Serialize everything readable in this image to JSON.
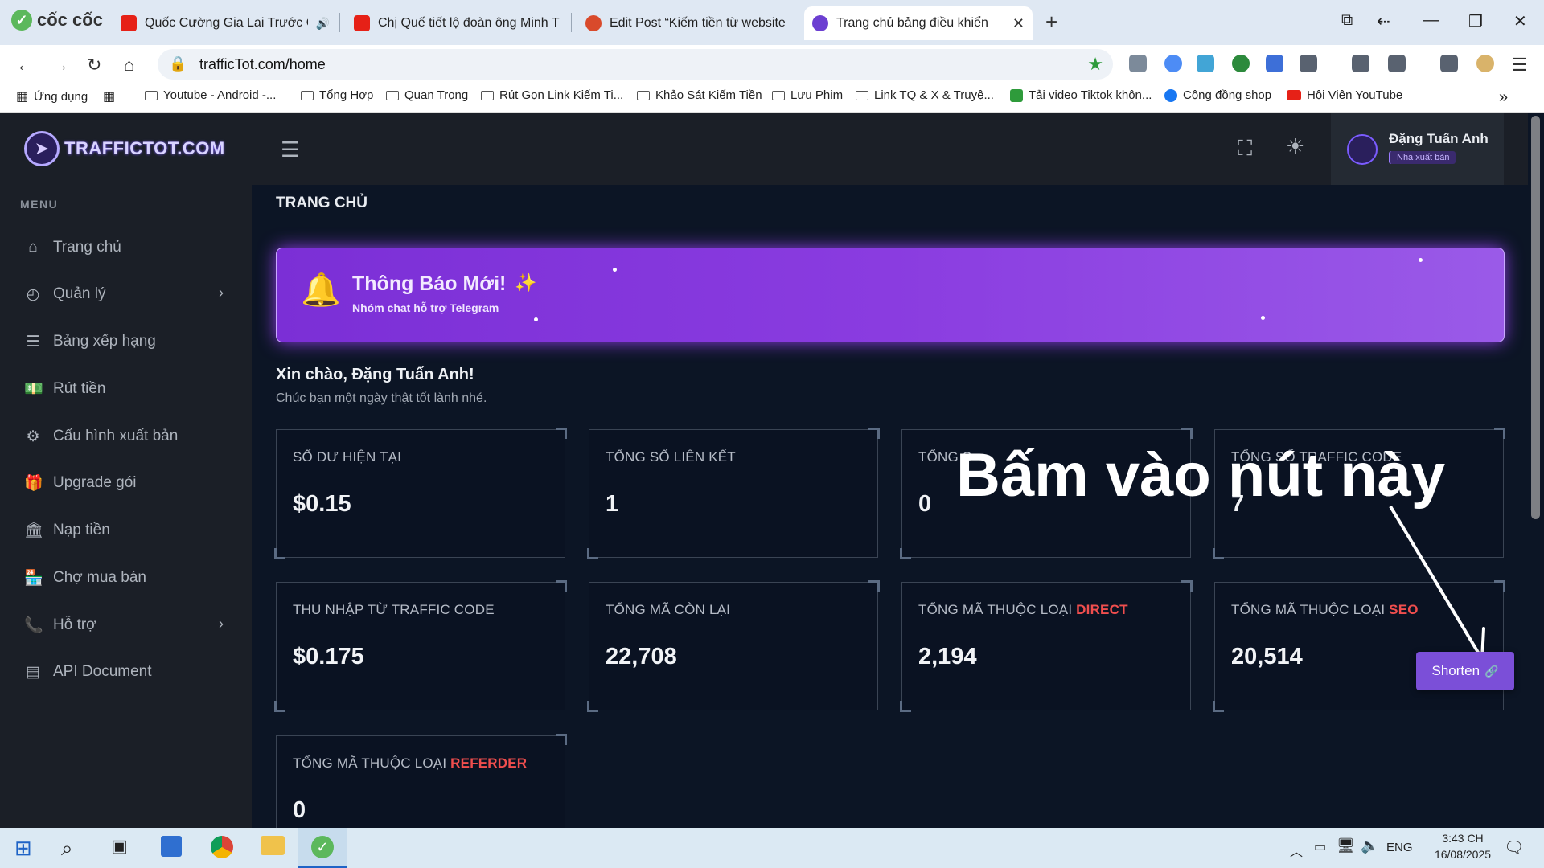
{
  "browser": {
    "brand": "cốc cốc",
    "tabs": [
      {
        "title": "Quốc Cường Gia Lai Trước Gi",
        "favicon_color": "#e62117"
      },
      {
        "title": "Chị Quế tiết lộ đoàn ông Minh T",
        "favicon_color": "#e62117"
      },
      {
        "title": "Edit Post “Kiếm tiền từ website n",
        "favicon_color": "#d94a2b"
      },
      {
        "title": "Trang chủ bảng điều khiển",
        "favicon_color": "#6c3fd1"
      }
    ],
    "url": "trafficTot.com/home",
    "bookmarks": [
      "Ứng dụng",
      "Youtube - Android -...",
      "Tổng Hợp",
      "Quan Trọng",
      "Rút Gọn Link Kiếm Ti...",
      "Khảo Sát Kiếm Tiền",
      "Lưu Phim",
      "Link TQ & X & Truyệ...",
      "Tải video Tiktok khôn...",
      "Cộng đồng shop",
      "Hội Viên YouTube"
    ]
  },
  "site": {
    "logo": "TRAFFICTOT.COM",
    "menu_header": "MENU",
    "menu": [
      {
        "label": "Trang chủ",
        "icon": "home-icon"
      },
      {
        "label": "Quản lý",
        "icon": "gauge-icon",
        "has_sub": true
      },
      {
        "label": "Bảng xếp hạng",
        "icon": "list-icon"
      },
      {
        "label": "Rút tiền",
        "icon": "withdraw-icon"
      },
      {
        "label": "Cấu hình xuất bản",
        "icon": "settings-icon"
      },
      {
        "label": "Upgrade gói",
        "icon": "gift-icon"
      },
      {
        "label": "Nạp tiền",
        "icon": "bank-icon"
      },
      {
        "label": "Chợ mua bán",
        "icon": "store-icon"
      },
      {
        "label": "Hỗ trợ",
        "icon": "phone-icon",
        "has_sub": true
      },
      {
        "label": "API Document",
        "icon": "document-icon"
      }
    ],
    "user": {
      "name": "Đặng Tuấn Anh",
      "role": "Nhà xuất bản"
    },
    "page_title": "TRANG CHỦ",
    "notice": {
      "title": "Thông Báo Mới!",
      "subtitle": "Nhóm chat hỗ trợ Telegram"
    },
    "greeting": "Xin chào, Đặng Tuấn Anh!",
    "greeting_sub": "Chúc bạn một ngày thật tốt lành nhé.",
    "cards": [
      {
        "label": "SỐ DƯ HIỆN TẠI",
        "highlight": "",
        "value": "$0.15"
      },
      {
        "label": "TỔNG SỐ LIÊN KẾT",
        "highlight": "",
        "value": "1"
      },
      {
        "label": "TỔNG S",
        "highlight": "",
        "value": "0"
      },
      {
        "label": "TỔNG SỐ TRAFFIC CODE",
        "highlight": "",
        "value": "7"
      },
      {
        "label": "THU NHẬP TỪ TRAFFIC CODE",
        "highlight": "",
        "value": "$0.175"
      },
      {
        "label": "TỔNG MÃ CÒN LẠI",
        "highlight": "",
        "value": "22,708"
      },
      {
        "label": "TỔNG MÃ THUỘC LOẠI ",
        "highlight": "DIRECT",
        "value": "2,194"
      },
      {
        "label": "TỔNG MÃ THUỘC LOẠI ",
        "highlight": "SEO",
        "value": "20,514"
      },
      {
        "label": "TỔNG MÃ THUỘC LOẠI ",
        "highlight": "REFERDER",
        "value": "0"
      }
    ],
    "shorten_button": "Shorten",
    "annotation": "Bấm vào nút này"
  },
  "taskbar": {
    "time": "3:43 CH",
    "date": "16/08/2025",
    "lang": "ENG"
  }
}
